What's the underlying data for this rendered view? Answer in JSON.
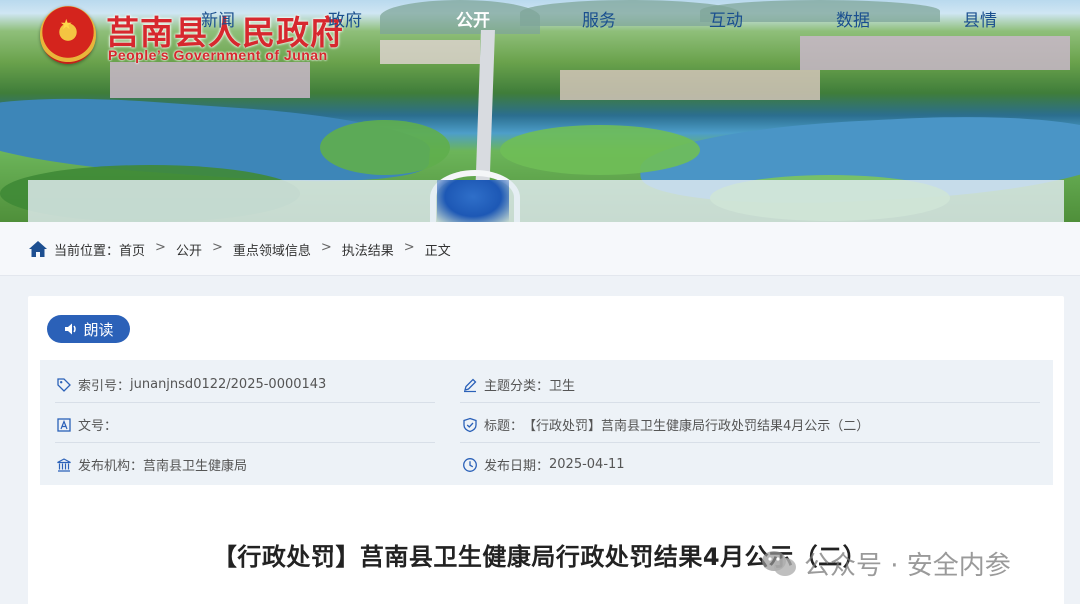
{
  "header": {
    "site_title": "莒南县人民政府",
    "site_subtitle": "People’s Government of Junan"
  },
  "nav": {
    "items": [
      {
        "label": "新闻"
      },
      {
        "label": "政府"
      },
      {
        "label": "公开"
      },
      {
        "label": "服务"
      },
      {
        "label": "互动"
      },
      {
        "label": "数据"
      },
      {
        "label": "县情"
      }
    ],
    "active": "公开"
  },
  "breadcrumb": {
    "prefix": "当前位置：",
    "items": [
      "首页",
      "公开",
      "重点领域信息",
      "执法结果",
      "正文"
    ],
    "separator": ">"
  },
  "read_button": {
    "label": "朗读"
  },
  "meta": {
    "index_label": "索引号：",
    "index_value": "junanjnsd0122/2025-0000143",
    "topic_label": "主题分类：",
    "topic_value": "卫生",
    "doc_no_label": "文号：",
    "doc_no_value": "",
    "title_label": "标题：",
    "title_value": "【行政处罚】莒南县卫生健康局行政处罚结果4月公示（二）",
    "publisher_label": "发布机构：",
    "publisher_value": "莒南县卫生健康局",
    "date_label": "发布日期：",
    "date_value": "2025-04-11"
  },
  "article": {
    "title": "【行政处罚】莒南县卫生健康局行政处罚结果4月公示（二）"
  },
  "watermark": {
    "text": "公众号 · 安全内参"
  },
  "colors": {
    "brand_red": "#d7282e",
    "nav_blue": "#1a4f8f",
    "accent_blue": "#2b61b8"
  }
}
